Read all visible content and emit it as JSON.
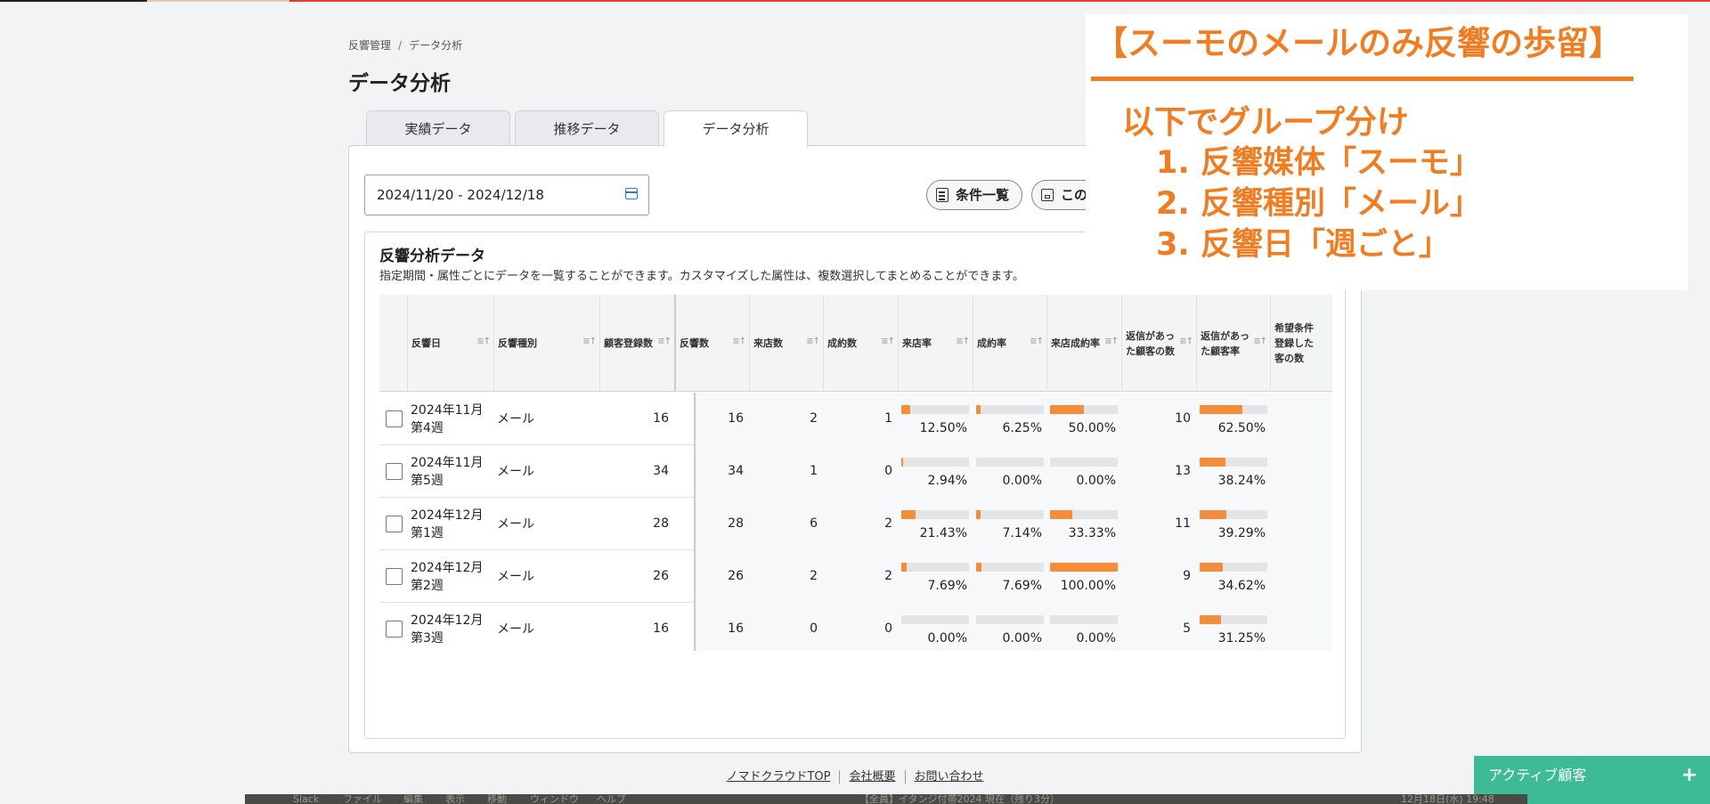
{
  "breadcrumb": {
    "parent": "反響管理",
    "separator": "/",
    "current": "データ分析"
  },
  "page_title": "データ分析",
  "tabs": [
    {
      "label": "実績データ",
      "active": false
    },
    {
      "label": "推移データ",
      "active": false
    },
    {
      "label": "データ分析",
      "active": true
    }
  ],
  "toolbar": {
    "date_range": "2024/11/20 - 2024/12/18",
    "conditions_button": "条件一覧",
    "save_button": "この"
  },
  "card": {
    "title": "反響分析データ",
    "description": "指定期間・属性ごとにデータを一覧することができます。カスタマイズした属性は、複数選択してまとめることができます。"
  },
  "table": {
    "columns": [
      "反響日",
      "反響種別",
      "顧客登録数",
      "反響数",
      "来店数",
      "成約数",
      "来店率",
      "成約率",
      "来店成約率",
      "返信があっ\nた顧客の数",
      "返信があっ\nた顧客率",
      "希望条件\n登録した\n客の数"
    ],
    "rows": [
      {
        "date": "2024年11月第4週",
        "type": "メール",
        "registered": "16",
        "responses": "16",
        "visits": "2",
        "contracts": "1",
        "visit_rate": "12.50%",
        "visit_rate_v": 12.5,
        "contract_rate": "6.25%",
        "contract_rate_v": 6.25,
        "visit_contract_rate": "50.00%",
        "visit_contract_rate_v": 50,
        "replied": "10",
        "replied_rate": "62.50%",
        "replied_rate_v": 62.5
      },
      {
        "date": "2024年11月第5週",
        "type": "メール",
        "registered": "34",
        "responses": "34",
        "visits": "1",
        "contracts": "0",
        "visit_rate": "2.94%",
        "visit_rate_v": 2.94,
        "contract_rate": "0.00%",
        "contract_rate_v": 0,
        "visit_contract_rate": "0.00%",
        "visit_contract_rate_v": 0,
        "replied": "13",
        "replied_rate": "38.24%",
        "replied_rate_v": 38.24
      },
      {
        "date": "2024年12月第1週",
        "type": "メール",
        "registered": "28",
        "responses": "28",
        "visits": "6",
        "contracts": "2",
        "visit_rate": "21.43%",
        "visit_rate_v": 21.43,
        "contract_rate": "7.14%",
        "contract_rate_v": 7.14,
        "visit_contract_rate": "33.33%",
        "visit_contract_rate_v": 33.33,
        "replied": "11",
        "replied_rate": "39.29%",
        "replied_rate_v": 39.29
      },
      {
        "date": "2024年12月第2週",
        "type": "メール",
        "registered": "26",
        "responses": "26",
        "visits": "2",
        "contracts": "2",
        "visit_rate": "7.69%",
        "visit_rate_v": 7.69,
        "contract_rate": "7.69%",
        "contract_rate_v": 7.69,
        "visit_contract_rate": "100.00%",
        "visit_contract_rate_v": 100,
        "replied": "9",
        "replied_rate": "34.62%",
        "replied_rate_v": 34.62
      },
      {
        "date": "2024年12月第3週",
        "type": "メール",
        "registered": "16",
        "responses": "16",
        "visits": "0",
        "contracts": "0",
        "visit_rate": "0.00%",
        "visit_rate_v": 0,
        "contract_rate": "0.00%",
        "contract_rate_v": 0,
        "visit_contract_rate": "0.00%",
        "visit_contract_rate_v": 0,
        "replied": "5",
        "replied_rate": "31.25%",
        "replied_rate_v": 31.25
      }
    ]
  },
  "footer": {
    "links": [
      "ノマドクラウドTOP",
      "会社概要",
      "お問い合わせ"
    ]
  },
  "annotation": {
    "title": "【スーモのメールのみ反響の歩留】",
    "subtitle": "以下でグループ分け",
    "items": [
      "1. 反響媒体「スーモ」",
      "2. 反響種別「メール」",
      "3. 反響日「週ごと」"
    ]
  },
  "chat_widget": {
    "label": "アクティブ顧客",
    "plus": "+"
  },
  "dock": {
    "items": [
      "Slack",
      "ファイル",
      "編集",
      "表示",
      "移動",
      "ウィンドウ",
      "ヘルプ"
    ],
    "center": "【全員】イタンジ付帯2024 現在（残り3分）",
    "clock": "12月18日(水) 19:48"
  },
  "colors": {
    "accent": "#f58c3a",
    "annotation": "#f07d22",
    "chat": "#3dbb95",
    "link_icon": "#2d7be0"
  }
}
